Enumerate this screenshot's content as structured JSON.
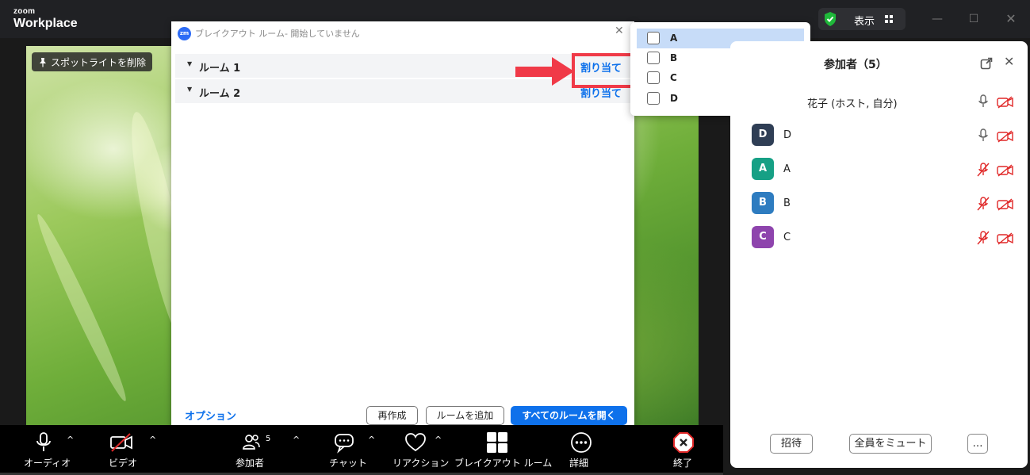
{
  "app": {
    "logo_top": "zoom",
    "logo_bottom": "Workplace",
    "view_label": "表示"
  },
  "video": {
    "spotlight_label": "スポットライトを削除"
  },
  "breakout": {
    "title": "ブレイクアウト ルーム- 開始していません",
    "rooms": [
      {
        "name": "ルーム 1",
        "assign_label": "割り当て"
      },
      {
        "name": "ルーム 2",
        "assign_label": "割り当て"
      }
    ],
    "options_label": "オプション",
    "recreate_label": "再作成",
    "add_room_label": "ルームを追加",
    "open_all_label": "すべてのルームを開く"
  },
  "assign_dropdown": {
    "items": [
      {
        "name": "A",
        "selected": true,
        "checked": false
      },
      {
        "name": "B",
        "selected": false,
        "checked": false
      },
      {
        "name": "C",
        "selected": false,
        "checked": false
      },
      {
        "name": "D",
        "selected": false,
        "checked": false
      }
    ]
  },
  "participants": {
    "title": "参加者（5）",
    "list": [
      {
        "initial": "",
        "name": "花子 (ホスト, 自分)",
        "color": "#ffffff",
        "mic": "on",
        "video": "off"
      },
      {
        "initial": "D",
        "name": "D",
        "color": "#2f3e55",
        "mic": "on",
        "video": "off"
      },
      {
        "initial": "A",
        "name": "A",
        "color": "#16a085",
        "mic": "muted",
        "video": "off"
      },
      {
        "initial": "B",
        "name": "B",
        "color": "#2e7cc0",
        "mic": "muted",
        "video": "off"
      },
      {
        "initial": "C",
        "name": "C",
        "color": "#8e44ad",
        "mic": "muted",
        "video": "off"
      }
    ],
    "invite_label": "招待",
    "mute_all_label": "全員をミュート",
    "more_label": "…"
  },
  "toolbar": {
    "audio_label": "オーディオ",
    "video_label": "ビデオ",
    "participants_label": "参加者",
    "participants_count": "5",
    "chat_label": "チャット",
    "reaction_label": "リアクション",
    "breakout_label": "ブレイクアウト ルーム",
    "more_label": "詳細",
    "end_label": "終了"
  },
  "colors": {
    "accent": "#0e71eb",
    "highlight": "#f03a48",
    "muted_red": "#e02828"
  }
}
